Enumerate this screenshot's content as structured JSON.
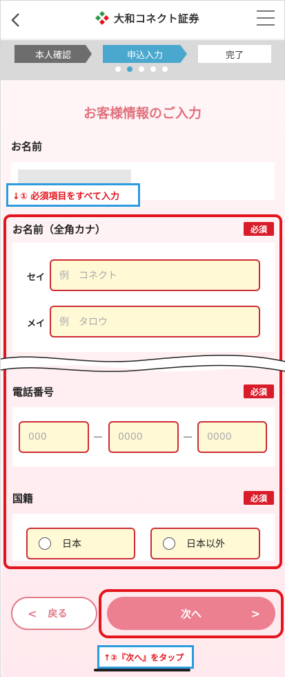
{
  "header": {
    "logo_text": "大和コネクト証券",
    "back_icon": "chevron-left-icon",
    "menu_icon": "hamburger-menu-icon"
  },
  "steps": [
    {
      "label": "本人確認",
      "state": "done"
    },
    {
      "label": "申込入力",
      "state": "current"
    },
    {
      "label": "完了",
      "state": "pending"
    }
  ],
  "progress": {
    "total": 5,
    "current": 2
  },
  "page_title": "お客様情報のご入力",
  "name_section": {
    "label": "お名前"
  },
  "annotation_top": "↓① 必須項目をすべて入力",
  "kana_section": {
    "label": "お名前（全角カナ）",
    "badge": "必須",
    "sei_label": "セイ",
    "sei_placeholder": "例　コネクト",
    "mei_label": "メイ",
    "mei_placeholder": "例　タロウ"
  },
  "phone_section": {
    "label": "電話番号",
    "badge": "必須",
    "part1_placeholder": "000",
    "part2_placeholder": "0000",
    "part3_placeholder": "0000"
  },
  "nationality_section": {
    "label": "国籍",
    "badge": "必須",
    "option1": "日本",
    "option2": "日本以外"
  },
  "buttons": {
    "back_label": "戻る",
    "next_label": "次へ"
  },
  "annotation_bottom": "↑②『次へ』をタップ",
  "colors": {
    "accent_pink": "#ed8090",
    "required_red": "#d91c2a",
    "step_blue": "#4aa8cf",
    "annotation_blue": "#2b9bdf"
  }
}
